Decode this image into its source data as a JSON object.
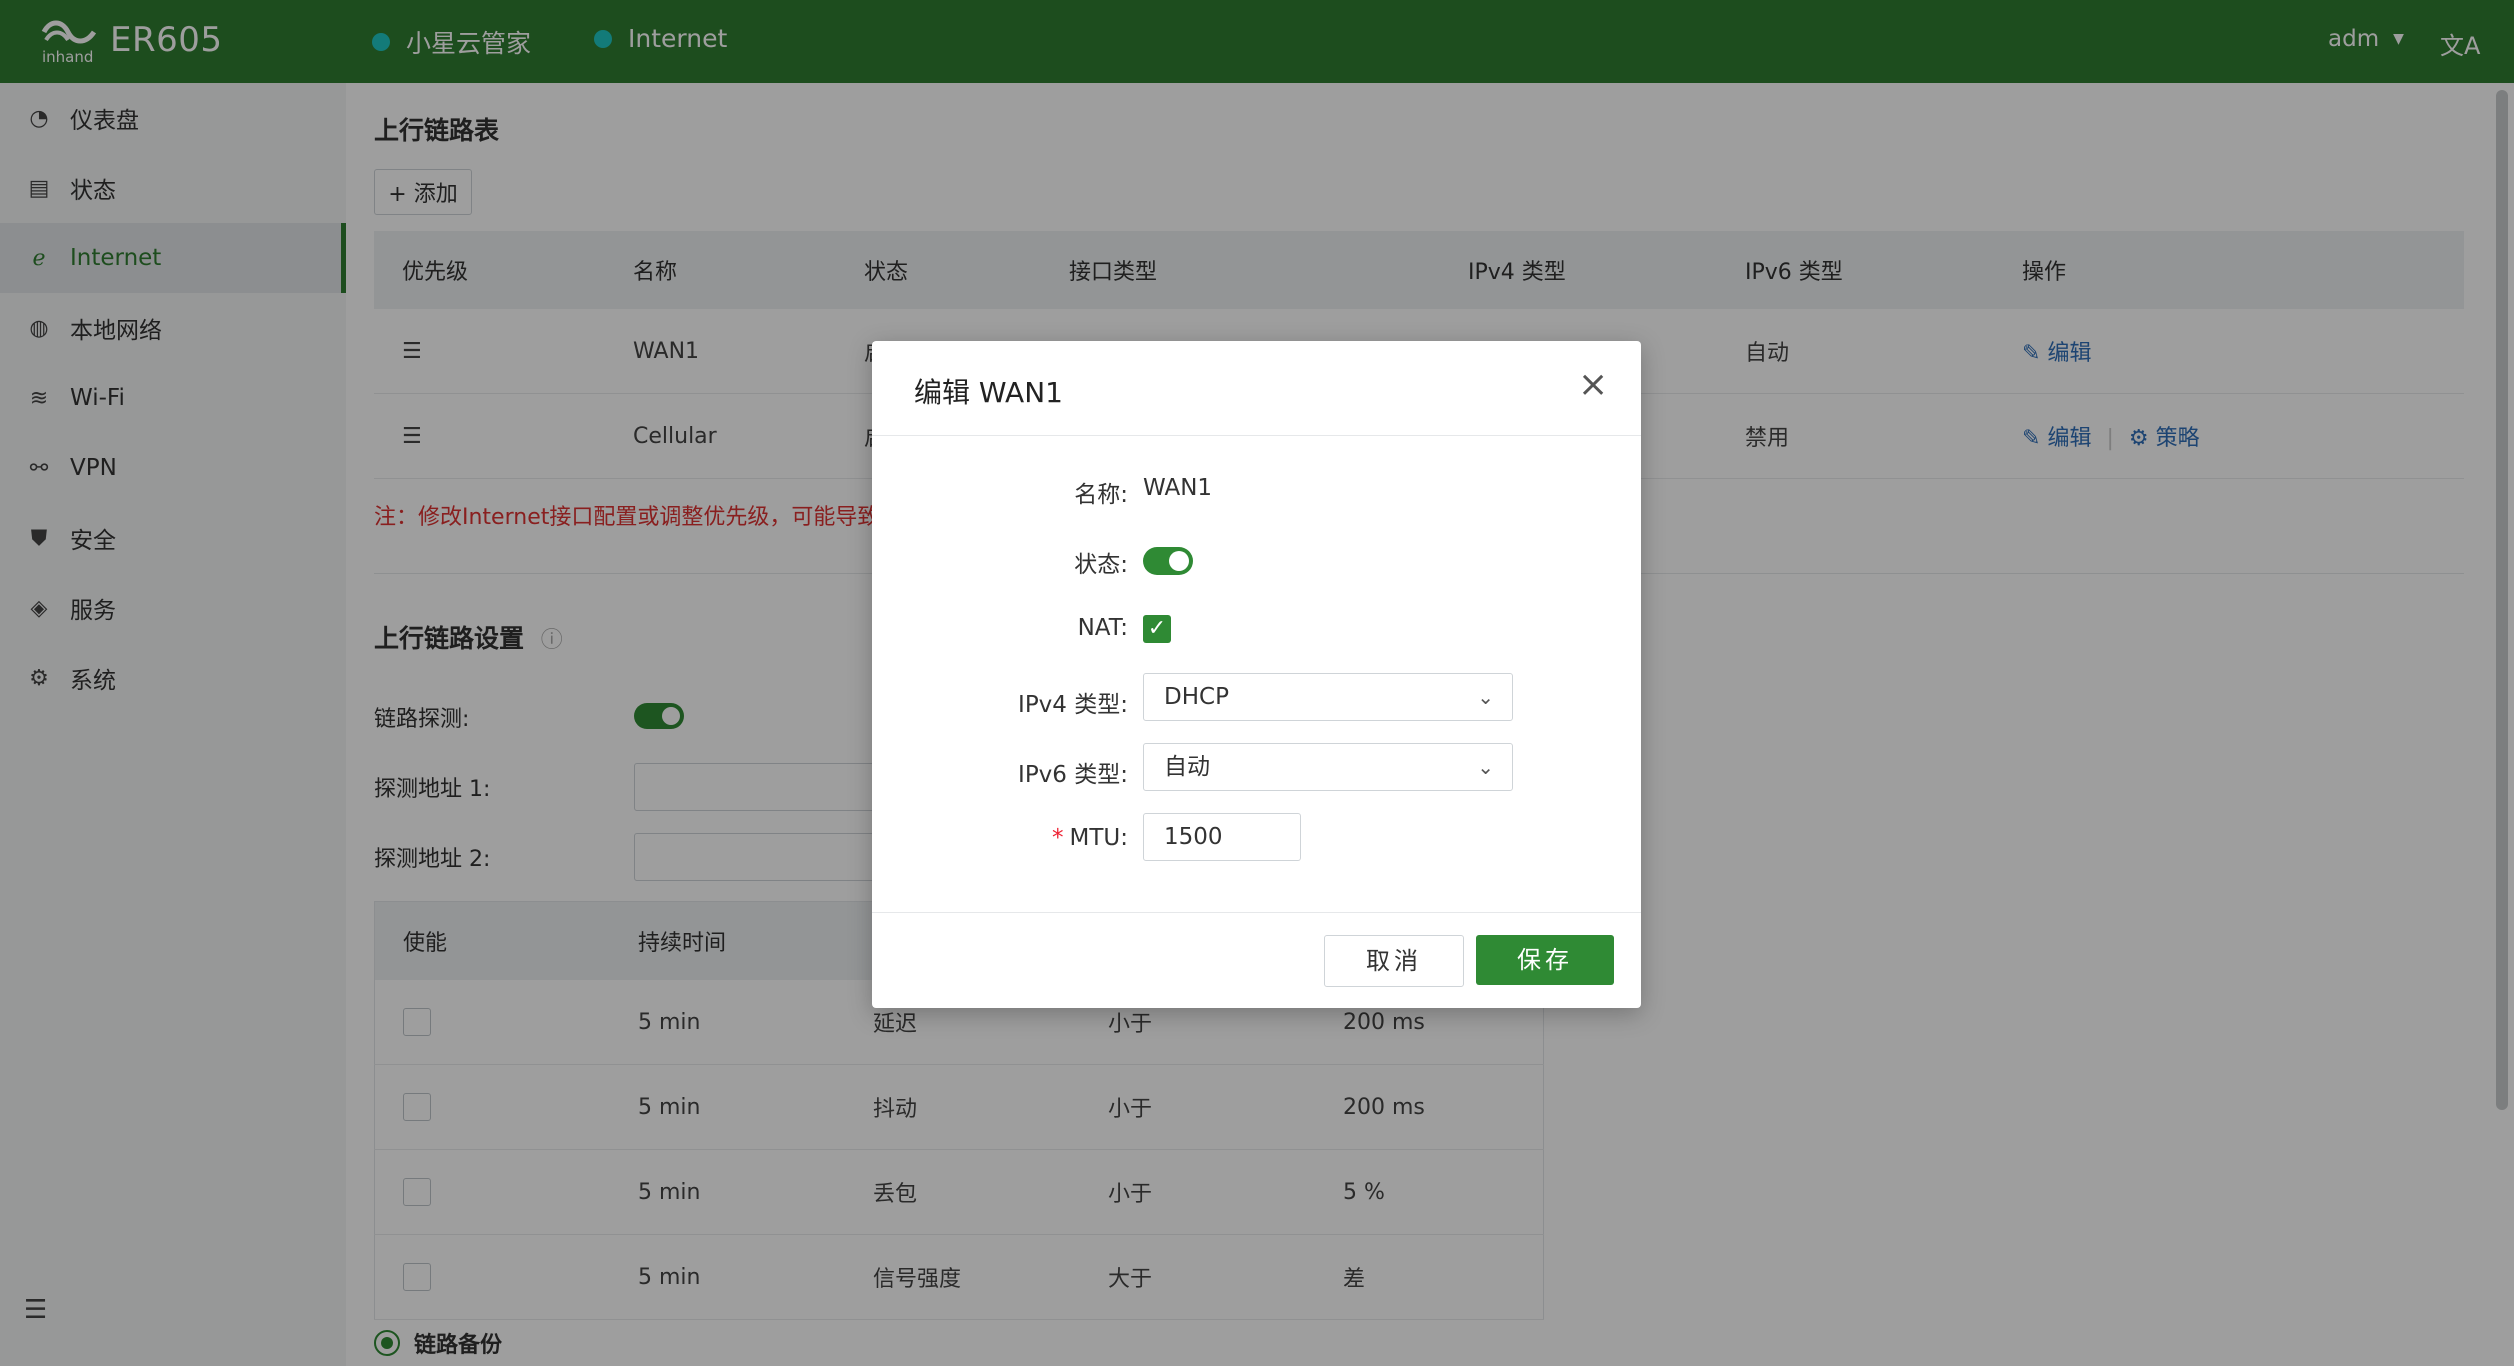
{
  "header": {
    "model": "ER605",
    "nav": [
      {
        "label": "小星云管家",
        "dot_color": "#20c7c4"
      },
      {
        "label": "Internet",
        "dot_color": "#20c7c4"
      }
    ],
    "user": "adm",
    "lang_glyph": "文A"
  },
  "sidebar": {
    "items": [
      {
        "label": "仪表盘",
        "icon": "dashboard-icon"
      },
      {
        "label": "状态",
        "icon": "status-icon"
      },
      {
        "label": "Internet",
        "icon": "internet-icon",
        "active": true
      },
      {
        "label": "本地网络",
        "icon": "globe-icon"
      },
      {
        "label": "Wi-Fi",
        "icon": "wifi-icon"
      },
      {
        "label": "VPN",
        "icon": "vpn-icon"
      },
      {
        "label": "安全",
        "icon": "shield-icon"
      },
      {
        "label": "服务",
        "icon": "cube-icon"
      },
      {
        "label": "系统",
        "icon": "gear-icon"
      }
    ]
  },
  "uplink_table": {
    "title": "上行链路表",
    "add_label": "+ 添加",
    "columns": [
      "优先级",
      "名称",
      "状态",
      "接口类型",
      "IPv4 类型",
      "IPv6 类型",
      "操作"
    ],
    "rows": [
      {
        "name": "WAN1",
        "status": "启",
        "ipv6": "自动",
        "edit": "编辑",
        "policy": ""
      },
      {
        "name": "Cellular",
        "status": "启",
        "ipv6": "禁用",
        "edit": "编辑",
        "policy": "策略"
      }
    ],
    "note": "注：修改Internet接口配置或调整优先级，可能导致"
  },
  "uplink_settings": {
    "title": "上行链路设置",
    "probe_label": "链路探测:",
    "addr1_label": "探测地址 1:",
    "addr2_label": "探测地址 2:",
    "columns": [
      "使能",
      "持续时间",
      "探"
    ],
    "rows": [
      {
        "duration": "5 min",
        "metric": "延迟",
        "cmp": "小于",
        "threshold": "200 ms"
      },
      {
        "duration": "5 min",
        "metric": "抖动",
        "cmp": "小于",
        "threshold": "200 ms"
      },
      {
        "duration": "5 min",
        "metric": "丢包",
        "cmp": "小于",
        "threshold": "5 %"
      },
      {
        "duration": "5 min",
        "metric": "信号强度",
        "cmp": "大于",
        "threshold": "差"
      }
    ],
    "backup_label": "链路备份"
  },
  "modal": {
    "title": "编辑 WAN1",
    "name_label": "名称:",
    "name_value": "WAN1",
    "status_label": "状态:",
    "nat_label": "NAT:",
    "ipv4_label": "IPv4 类型:",
    "ipv4_value": "DHCP",
    "ipv6_label": "IPv6 类型:",
    "ipv6_value": "自动",
    "mtu_label": "MTU:",
    "mtu_value": "1500",
    "cancel_label": "取消",
    "save_label": "保存"
  }
}
